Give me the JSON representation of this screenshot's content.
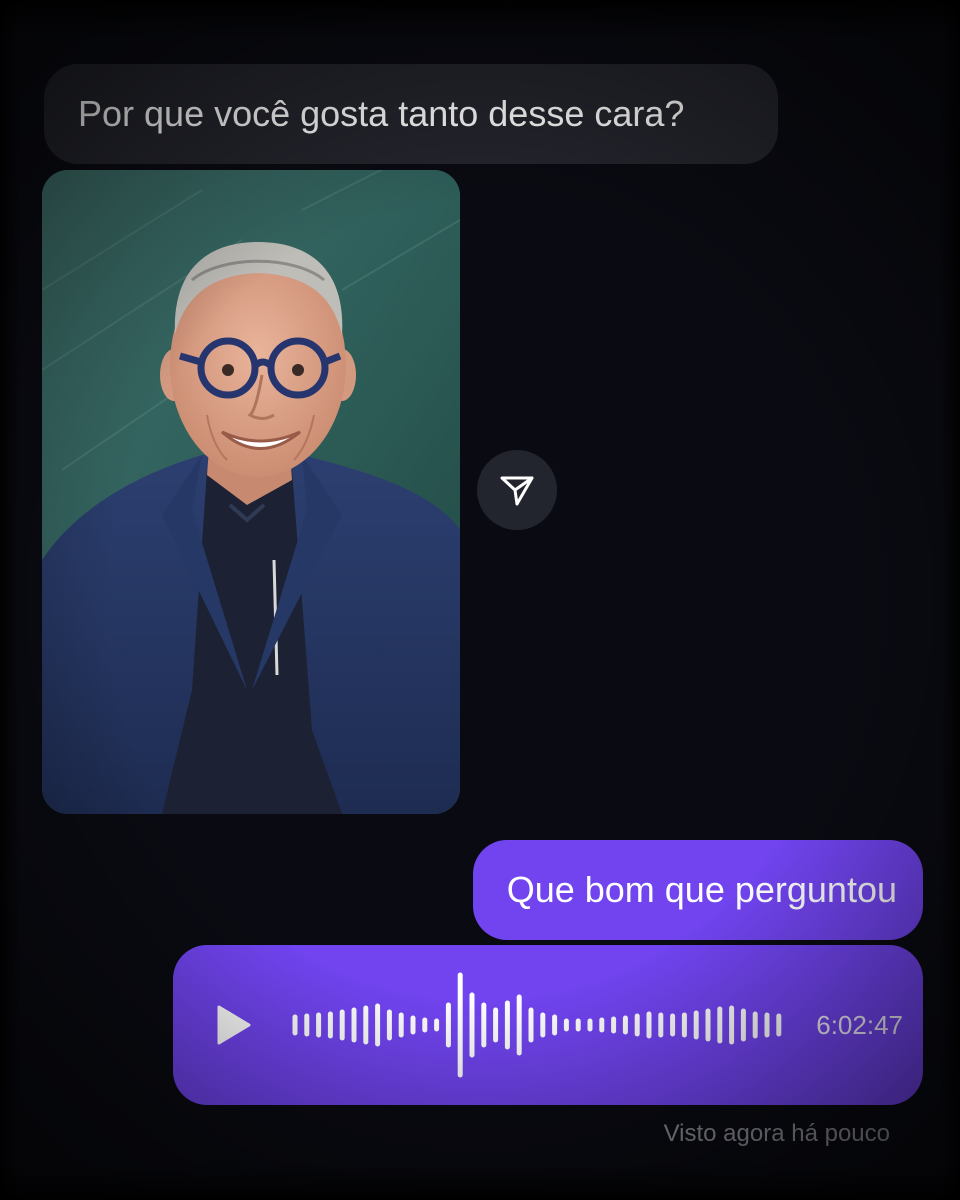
{
  "messages": {
    "incoming_text": "Por que você gosta tanto desse cara?",
    "outgoing_text": "Que bom que perguntou"
  },
  "photo": {
    "subject": "smiling older man with blue round glasses and navy blazer"
  },
  "share_button": {
    "icon": "send-icon"
  },
  "voice_message": {
    "duration": "6:02:47",
    "play_icon": "play-icon"
  },
  "status": {
    "seen_text": "Visto agora há pouco"
  },
  "colors": {
    "background": "#0a0b12",
    "incoming_bubble": "#24252d",
    "outgoing_bubble": "#7144f0",
    "seen_text": "#8b8c94"
  }
}
